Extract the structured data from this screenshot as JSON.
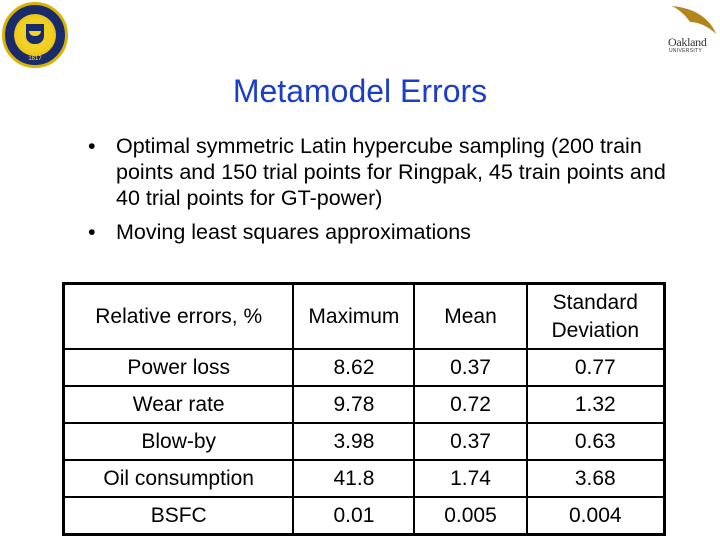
{
  "logos": {
    "left": {
      "name": "University of Michigan seal",
      "year": "1817"
    },
    "right": {
      "wordmark": "Oakland",
      "subtitle": "UNIVERSITY"
    }
  },
  "title": "Metamodel Errors",
  "bullets": [
    {
      "marker": "•",
      "text": "Optimal symmetric Latin hypercube sampling (200 train points and 150 trial points for Ringpak, 45 train points and 40 trial points for GT-power)"
    },
    {
      "marker": "•",
      "text": "Moving least squares approximations"
    }
  ],
  "table": {
    "headers": [
      "Relative errors, %",
      "Maximum",
      "Mean",
      "Standard Deviation"
    ],
    "rows": [
      [
        "Power loss",
        "8.62",
        "0.37",
        "0.77"
      ],
      [
        "Wear rate",
        "9.78",
        "0.72",
        "1.32"
      ],
      [
        "Blow-by",
        "3.98",
        "0.37",
        "0.63"
      ],
      [
        "Oil consumption",
        "41.8",
        "1.74",
        "3.68"
      ],
      [
        "BSFC",
        "0.01",
        "0.005",
        "0.004"
      ]
    ]
  },
  "colors": {
    "title": "#1a3ec8",
    "text": "#000000",
    "background": "#ffffff"
  }
}
